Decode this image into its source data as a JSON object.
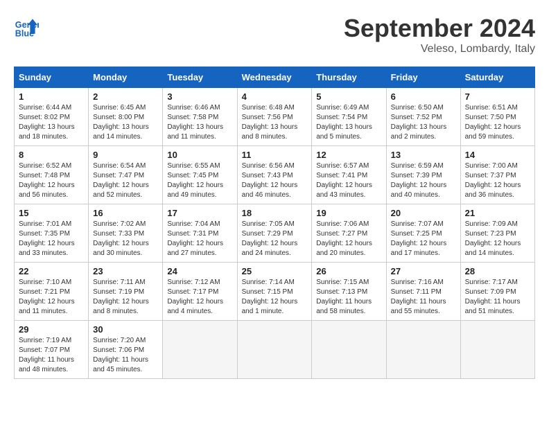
{
  "header": {
    "logo_line1": "General",
    "logo_line2": "Blue",
    "month": "September 2024",
    "location": "Veleso, Lombardy, Italy"
  },
  "weekdays": [
    "Sunday",
    "Monday",
    "Tuesday",
    "Wednesday",
    "Thursday",
    "Friday",
    "Saturday"
  ],
  "weeks": [
    [
      {
        "day": "1",
        "sunrise": "6:44 AM",
        "sunset": "8:02 PM",
        "daylight": "13 hours and 18 minutes."
      },
      {
        "day": "2",
        "sunrise": "6:45 AM",
        "sunset": "8:00 PM",
        "daylight": "13 hours and 14 minutes."
      },
      {
        "day": "3",
        "sunrise": "6:46 AM",
        "sunset": "7:58 PM",
        "daylight": "13 hours and 11 minutes."
      },
      {
        "day": "4",
        "sunrise": "6:48 AM",
        "sunset": "7:56 PM",
        "daylight": "13 hours and 8 minutes."
      },
      {
        "day": "5",
        "sunrise": "6:49 AM",
        "sunset": "7:54 PM",
        "daylight": "13 hours and 5 minutes."
      },
      {
        "day": "6",
        "sunrise": "6:50 AM",
        "sunset": "7:52 PM",
        "daylight": "13 hours and 2 minutes."
      },
      {
        "day": "7",
        "sunrise": "6:51 AM",
        "sunset": "7:50 PM",
        "daylight": "12 hours and 59 minutes."
      }
    ],
    [
      {
        "day": "8",
        "sunrise": "6:52 AM",
        "sunset": "7:48 PM",
        "daylight": "12 hours and 56 minutes."
      },
      {
        "day": "9",
        "sunrise": "6:54 AM",
        "sunset": "7:47 PM",
        "daylight": "12 hours and 52 minutes."
      },
      {
        "day": "10",
        "sunrise": "6:55 AM",
        "sunset": "7:45 PM",
        "daylight": "12 hours and 49 minutes."
      },
      {
        "day": "11",
        "sunrise": "6:56 AM",
        "sunset": "7:43 PM",
        "daylight": "12 hours and 46 minutes."
      },
      {
        "day": "12",
        "sunrise": "6:57 AM",
        "sunset": "7:41 PM",
        "daylight": "12 hours and 43 minutes."
      },
      {
        "day": "13",
        "sunrise": "6:59 AM",
        "sunset": "7:39 PM",
        "daylight": "12 hours and 40 minutes."
      },
      {
        "day": "14",
        "sunrise": "7:00 AM",
        "sunset": "7:37 PM",
        "daylight": "12 hours and 36 minutes."
      }
    ],
    [
      {
        "day": "15",
        "sunrise": "7:01 AM",
        "sunset": "7:35 PM",
        "daylight": "12 hours and 33 minutes."
      },
      {
        "day": "16",
        "sunrise": "7:02 AM",
        "sunset": "7:33 PM",
        "daylight": "12 hours and 30 minutes."
      },
      {
        "day": "17",
        "sunrise": "7:04 AM",
        "sunset": "7:31 PM",
        "daylight": "12 hours and 27 minutes."
      },
      {
        "day": "18",
        "sunrise": "7:05 AM",
        "sunset": "7:29 PM",
        "daylight": "12 hours and 24 minutes."
      },
      {
        "day": "19",
        "sunrise": "7:06 AM",
        "sunset": "7:27 PM",
        "daylight": "12 hours and 20 minutes."
      },
      {
        "day": "20",
        "sunrise": "7:07 AM",
        "sunset": "7:25 PM",
        "daylight": "12 hours and 17 minutes."
      },
      {
        "day": "21",
        "sunrise": "7:09 AM",
        "sunset": "7:23 PM",
        "daylight": "12 hours and 14 minutes."
      }
    ],
    [
      {
        "day": "22",
        "sunrise": "7:10 AM",
        "sunset": "7:21 PM",
        "daylight": "12 hours and 11 minutes."
      },
      {
        "day": "23",
        "sunrise": "7:11 AM",
        "sunset": "7:19 PM",
        "daylight": "12 hours and 8 minutes."
      },
      {
        "day": "24",
        "sunrise": "7:12 AM",
        "sunset": "7:17 PM",
        "daylight": "12 hours and 4 minutes."
      },
      {
        "day": "25",
        "sunrise": "7:14 AM",
        "sunset": "7:15 PM",
        "daylight": "12 hours and 1 minute."
      },
      {
        "day": "26",
        "sunrise": "7:15 AM",
        "sunset": "7:13 PM",
        "daylight": "11 hours and 58 minutes."
      },
      {
        "day": "27",
        "sunrise": "7:16 AM",
        "sunset": "7:11 PM",
        "daylight": "11 hours and 55 minutes."
      },
      {
        "day": "28",
        "sunrise": "7:17 AM",
        "sunset": "7:09 PM",
        "daylight": "11 hours and 51 minutes."
      }
    ],
    [
      {
        "day": "29",
        "sunrise": "7:19 AM",
        "sunset": "7:07 PM",
        "daylight": "11 hours and 48 minutes."
      },
      {
        "day": "30",
        "sunrise": "7:20 AM",
        "sunset": "7:06 PM",
        "daylight": "11 hours and 45 minutes."
      },
      null,
      null,
      null,
      null,
      null
    ]
  ]
}
